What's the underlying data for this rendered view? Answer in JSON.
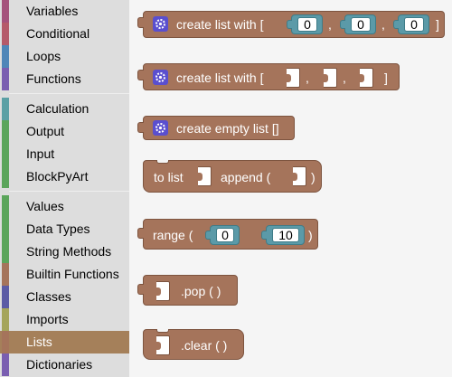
{
  "sidebar": {
    "categories": [
      {
        "label": "Variables",
        "color": "#a5527c"
      },
      {
        "label": "Conditional",
        "color": "#b55a6a"
      },
      {
        "label": "Loops",
        "color": "#4f86b8"
      },
      {
        "label": "Functions",
        "color": "#7a5eb1"
      },
      {
        "label": "Calculation",
        "color": "#5ba0a5"
      },
      {
        "label": "Output",
        "color": "#5ba55b"
      },
      {
        "label": "Input",
        "color": "#5ba55b"
      },
      {
        "label": "BlockPyArt",
        "color": "#5ba55b"
      },
      {
        "label": "Values",
        "color": "#5ba55b"
      },
      {
        "label": "Data Types",
        "color": "#5ba55b"
      },
      {
        "label": "String Methods",
        "color": "#5ba55b"
      },
      {
        "label": "Builtin Functions",
        "color": "#a5745b"
      },
      {
        "label": "Classes",
        "color": "#5b5ba5"
      },
      {
        "label": "Imports",
        "color": "#a5a55b"
      },
      {
        "label": "Lists",
        "color": "#a5745b"
      },
      {
        "label": "Dictionaries",
        "color": "#7a5eb1"
      }
    ],
    "selected": "Lists"
  },
  "blocks": {
    "create_list_values": {
      "text": "create list with [",
      "sep1": ",",
      "sep2": ",",
      "close": "]",
      "values": [
        "0",
        "0",
        "0"
      ]
    },
    "create_list_empty_slots": {
      "text": "create list with [",
      "sep1": ",",
      "sep2": ",",
      "close": "]"
    },
    "create_empty_list": {
      "text": "create empty list []"
    },
    "append": {
      "prefix": "to list",
      "middle": "append (",
      "close": ")"
    },
    "range": {
      "text": "range (",
      "start": "0",
      "stop": "10",
      "close": ")"
    },
    "pop": {
      "text": ".pop (  )"
    },
    "clear": {
      "text": ".clear (  )"
    }
  },
  "colors": {
    "list_block": "#a5745b",
    "number_block": "#5b9aa8",
    "mutator_gear": "#5a4fcf",
    "selected_category": "#a5805a"
  }
}
